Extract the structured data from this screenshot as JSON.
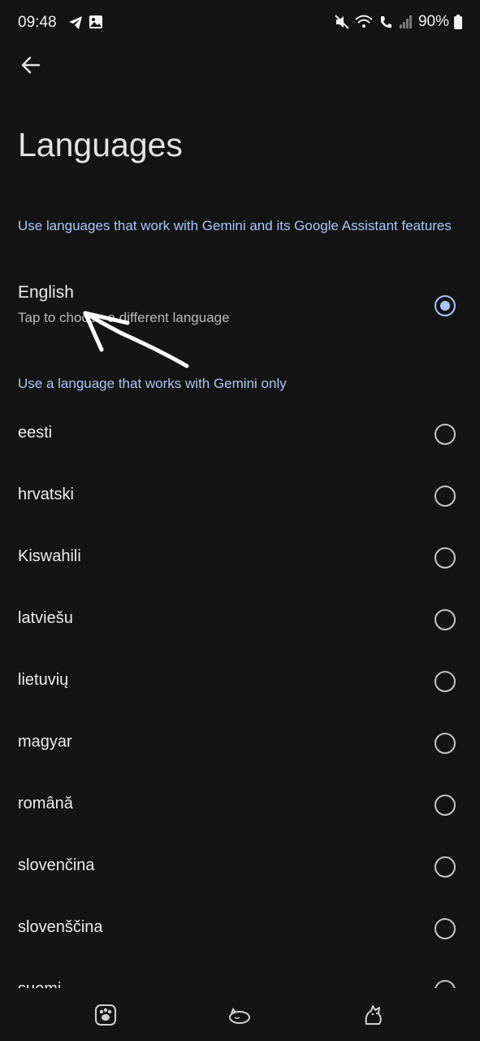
{
  "status_bar": {
    "time": "09:48",
    "battery": "90%"
  },
  "header": {
    "back_icon": "arrow-left-icon",
    "title": "Languages"
  },
  "sections": {
    "assistant_header": "Use languages that work with Gemini and its Google Assistant features",
    "gemini_only_header": "Use a language that works with Gemini only"
  },
  "selected_language": {
    "label": "English",
    "subtitle": "Tap to choose a different language",
    "selected": true
  },
  "languages": [
    {
      "label": "eesti"
    },
    {
      "label": "hrvatski"
    },
    {
      "label": "Kiswahili"
    },
    {
      "label": "latviešu"
    },
    {
      "label": "lietuvių"
    },
    {
      "label": "magyar"
    },
    {
      "label": "română"
    },
    {
      "label": "slovenčina"
    },
    {
      "label": "slovenščina"
    },
    {
      "label": "suomi"
    }
  ],
  "colors": {
    "background": "#141414",
    "accent": "#a8c7fa",
    "text": "#ececec"
  },
  "bottom_nav": [
    "paw-icon",
    "cat-sleeping-icon",
    "cat-icon"
  ]
}
